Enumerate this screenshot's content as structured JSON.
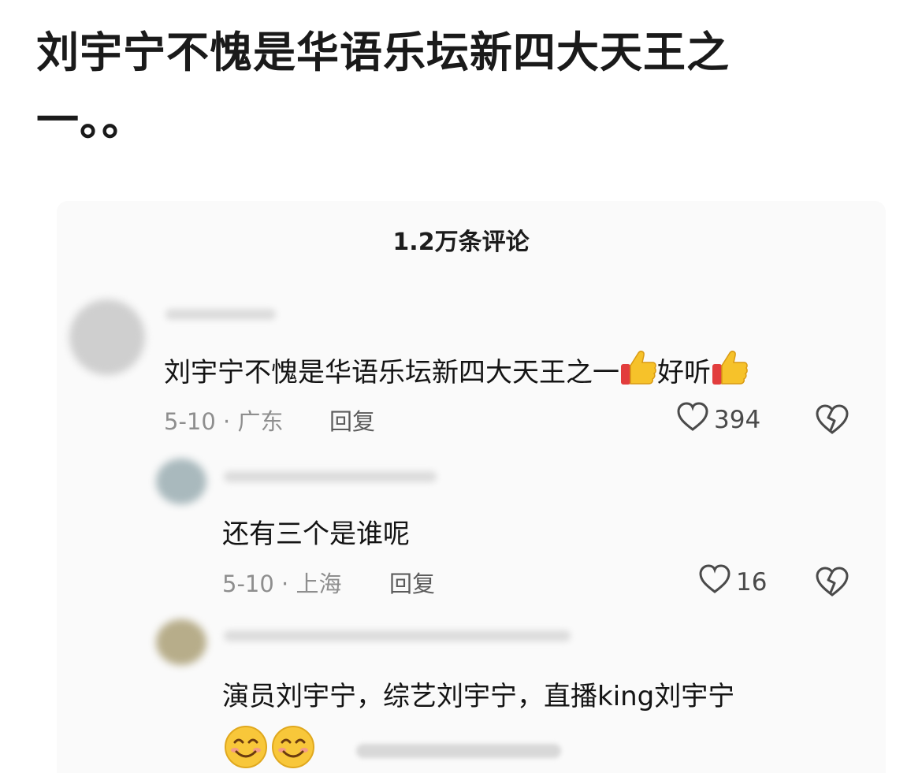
{
  "post": {
    "title": "刘宇宁不愧是华语乐坛新四大天王之一。。"
  },
  "comments_panel": {
    "count_label": "1.2万条评论"
  },
  "comments": [
    {
      "text": "刘宇宁不愧是华语乐坛新四大天王之一",
      "text_suffix": "好听",
      "meta": "5-10 · 广东",
      "reply_label": "回复",
      "likes": "394",
      "icons": [
        "heart-icon",
        "dislike-broken-heart-icon",
        "thumbs-up-emoji"
      ]
    },
    {
      "text": "还有三个是谁呢",
      "meta": "5-10 · 上海",
      "reply_label": "回复",
      "likes": "16",
      "icons": [
        "heart-icon",
        "dislike-broken-heart-icon"
      ]
    },
    {
      "text": "演员刘宇宁，综艺刘宇宁，直播king刘宇宁",
      "icons": [
        "smiling-face-emoji"
      ]
    }
  ],
  "colors": {
    "text": "#141414",
    "meta": "#8e8e8e",
    "panel": "#fafafa",
    "thumb": "#f6c22a",
    "cuff": "#e23d3d",
    "emoji": "#f8c73a"
  }
}
